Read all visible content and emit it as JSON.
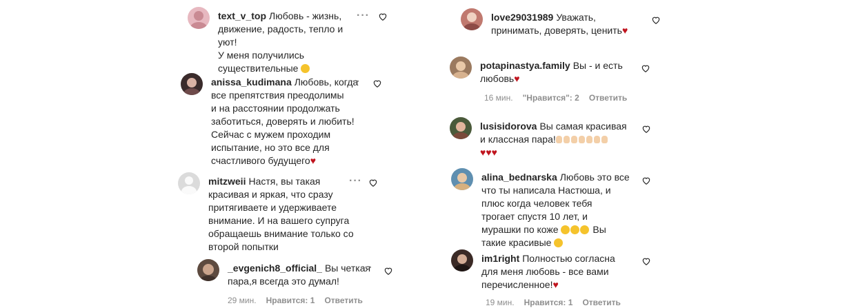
{
  "left": [
    {
      "username": "text_v_top",
      "lines": [
        "Любовь - жизнь,",
        "движение, радость, тепло и уют!",
        "У меня получились",
        "существительные"
      ],
      "emoji_after_last": "grin",
      "avatar": {
        "bg": "#e7b8c0",
        "fg": "#c98a93"
      }
    },
    {
      "username": "anissa_kudimana",
      "lines": [
        "Любовь, когда",
        "все препятствия преодолимы",
        "и на расстоянии продолжать",
        "заботиться, доверять и любить!",
        "Сейчас с мужем проходим",
        "испытание, но это все для",
        "счастливого будущего"
      ],
      "emoji_after_last": "heart",
      "avatar": {
        "bg": "#3a2b2b",
        "fg": "#d9b2a4"
      }
    },
    {
      "username": "mitzweii",
      "lines": [
        "Настя, вы такая",
        "красивая и яркая, что сразу",
        "притягиваете и удерживаете",
        "внимание. И на вашего супруга",
        "обращаешь внимание только со",
        "второй попытки"
      ],
      "avatar": {
        "empty": true
      }
    },
    {
      "username": "_evgenich8_official_",
      "lines": [
        "Вы четкая",
        "пара,я всегда это думал!"
      ],
      "avatar": {
        "bg": "#5d4a3f",
        "fg": "#caa48c"
      },
      "meta": {
        "time": "29 мин.",
        "likes": "Нравится: 1",
        "reply": "Ответить"
      }
    }
  ],
  "right": [
    {
      "username": "love29031989",
      "lines": [
        "Уважать,",
        "принимать, доверять, ценить"
      ],
      "emoji_after_last": "heart",
      "avatar": {
        "bg": "#c0796f",
        "fg": "#f0d2c2"
      }
    },
    {
      "username": "potapinastya.family",
      "lines": [
        "Вы - и есть",
        "любовь"
      ],
      "emoji_after_last": "heart",
      "avatar": {
        "bg": "#9b7a5f",
        "fg": "#e9c9a8"
      },
      "meta": {
        "time": "16 мин.",
        "likes": "\"Нравится\": 2",
        "reply": "Ответить"
      }
    },
    {
      "username": "lusisidorova",
      "lines": [
        "Вы самая красивая",
        "и классная пара!"
      ],
      "extra_line_hearts": 3,
      "claps": 7,
      "avatar": {
        "bg": "#4a5a3a",
        "fg": "#e2b59c"
      }
    },
    {
      "username": "alina_bednarska",
      "lines": [
        "Любовь это все",
        "что ты написала Настюша, и",
        "плюс когда человек тебя",
        "трогает спустя 10 лет, и",
        "мурашки по коже",
        "такие красивые"
      ],
      "avatar": {
        "bg": "#5f8fb0",
        "fg": "#e8c8a6"
      }
    },
    {
      "username": "im1right",
      "lines": [
        "Полностью согласна",
        "для меня любовь - все вами",
        "перечисленное!"
      ],
      "emoji_after_last": "heart",
      "avatar": {
        "bg": "#3b2a26",
        "fg": "#d4ad96"
      },
      "meta": {
        "time": "19 мин.",
        "likes": "Нравится: 1",
        "reply": "Ответить"
      }
    }
  ],
  "mitz_vi": "Вы",
  "colors": {
    "text": "#262626",
    "muted": "#8e8e8e",
    "heart": "#c0151f"
  }
}
